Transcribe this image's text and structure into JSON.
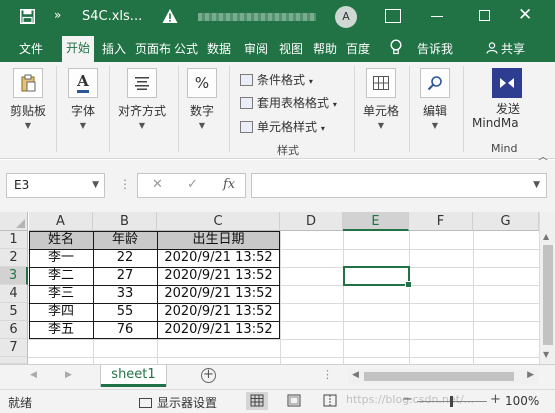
{
  "titlebar": {
    "more": "»",
    "filename": "S4C.xls...",
    "avatar": "A",
    "close": "✕"
  },
  "menu": {
    "tabs": [
      "文件",
      "开始",
      "插入",
      "页面布",
      "公式",
      "数据",
      "审阅",
      "视图",
      "帮助",
      "百度",
      "告诉我",
      "共享"
    ],
    "active": "开始"
  },
  "ribbon": {
    "clipboard": "剪贴板",
    "font": "字体",
    "alignment": "对齐方式",
    "number": "数字",
    "percent_symbol": "%",
    "conditional": "条件格式",
    "table_format": "套用表格格式",
    "cell_style": "单元格样式",
    "styles_group": "样式",
    "cells": "单元格",
    "editing": "编辑",
    "send_top": "发送",
    "send_bottom": "MindMa",
    "mind_group": "Mind"
  },
  "formula_bar": {
    "name_box": "E3",
    "cancel": "✕",
    "enter": "✓",
    "fx": "fx",
    "value": ""
  },
  "grid": {
    "columns": [
      "A",
      "B",
      "C",
      "D",
      "E",
      "F",
      "G"
    ],
    "rows": [
      "1",
      "2",
      "3",
      "4",
      "5",
      "6",
      "7"
    ],
    "selected_column": "E",
    "selected_row": "3",
    "header": [
      "姓名",
      "年龄",
      "出生日期"
    ],
    "data": [
      [
        "李一",
        "22",
        "2020/9/21 13:52"
      ],
      [
        "李二",
        "27",
        "2020/9/21 13:52"
      ],
      [
        "李三",
        "33",
        "2020/9/21 13:52"
      ],
      [
        "李四",
        "55",
        "2020/9/21 13:52"
      ],
      [
        "李五",
        "76",
        "2020/9/21 13:52"
      ]
    ]
  },
  "sheets": {
    "active": "sheet1",
    "add": "+"
  },
  "status": {
    "ready": "就绪",
    "display_settings": "显示器设置",
    "zoom": "100%",
    "watermark": "https://blog.csdn.net/..."
  }
}
